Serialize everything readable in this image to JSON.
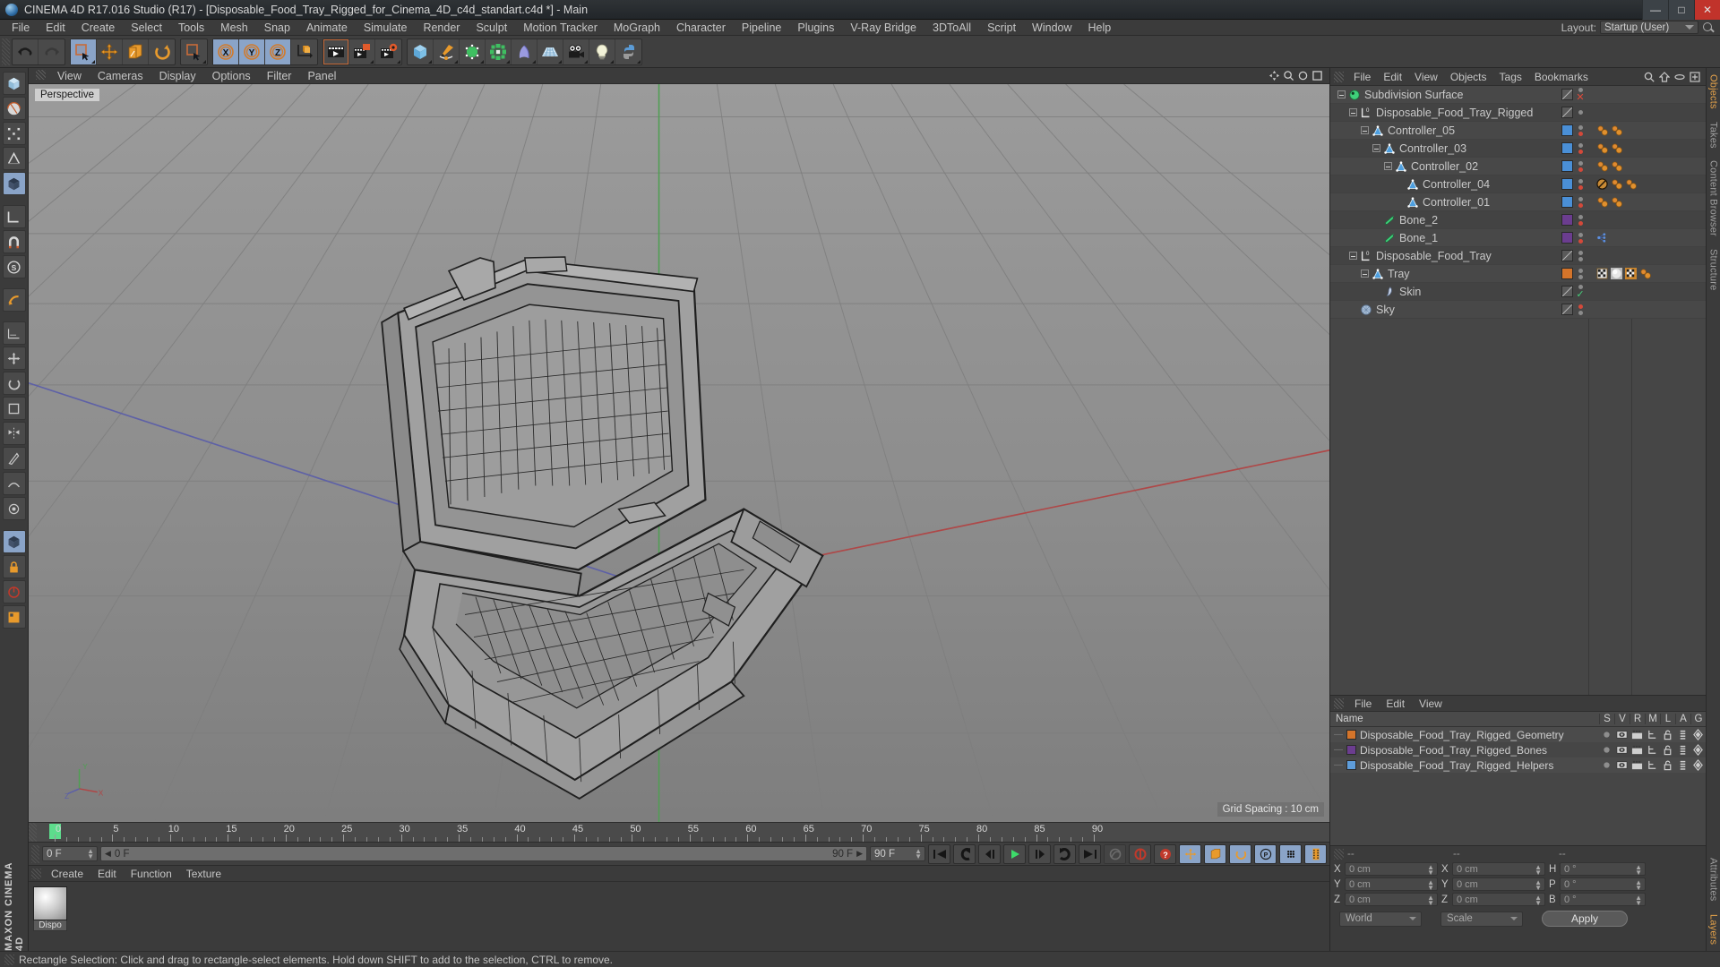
{
  "window": {
    "title": "CINEMA 4D R17.016 Studio (R17) - [Disposable_Food_Tray_Rigged_for_Cinema_4D_c4d_standart.c4d *] - Main",
    "minimize": "—",
    "maximize": "□",
    "close": "✕"
  },
  "menubar": {
    "items": [
      "File",
      "Edit",
      "Create",
      "Select",
      "Tools",
      "Mesh",
      "Snap",
      "Animate",
      "Simulate",
      "Render",
      "Sculpt",
      "Motion Tracker",
      "MoGraph",
      "Character",
      "Pipeline",
      "Plugins",
      "V-Ray Bridge",
      "3DToAll",
      "Script",
      "Window",
      "Help"
    ],
    "layout_label": "Layout:",
    "layout_value": "Startup (User)"
  },
  "viewport": {
    "menu": [
      "View",
      "Cameras",
      "Display",
      "Options",
      "Filter",
      "Panel"
    ],
    "label": "Perspective",
    "grid_spacing": "Grid Spacing : 10 cm",
    "axis_x": "X",
    "axis_y": "Y",
    "axis_z": "Z"
  },
  "timeline": {
    "ticks": [
      "0",
      "5",
      "10",
      "15",
      "20",
      "25",
      "30",
      "35",
      "40",
      "45",
      "50",
      "55",
      "60",
      "65",
      "70",
      "75",
      "80",
      "85",
      "90"
    ],
    "current_frame": "0 F",
    "preview_start": "0 F",
    "range_end_right": "90 F",
    "range_end_field": "90 F"
  },
  "material_manager": {
    "menu": [
      "Create",
      "Edit",
      "Function",
      "Texture"
    ],
    "materials": [
      {
        "name": "Dispo"
      }
    ]
  },
  "object_manager": {
    "menu": [
      "File",
      "Edit",
      "View",
      "Objects",
      "Tags",
      "Bookmarks"
    ],
    "tree": [
      {
        "name": "Subdivision Surface",
        "depth": 0,
        "icon": "subdivision-surface",
        "expander": "minus",
        "swatch": "none",
        "dots": [
          "gray",
          "red-x"
        ],
        "tags": []
      },
      {
        "name": "Disposable_Food_Tray_Rigged",
        "depth": 1,
        "icon": "layer-null",
        "expander": "minus",
        "swatch": "none",
        "dots": [
          "gray"
        ],
        "tags": []
      },
      {
        "name": "Controller_05",
        "depth": 2,
        "icon": "joint",
        "expander": "minus",
        "swatch": "#4a8fd6",
        "dots": [
          "gray",
          "red"
        ],
        "tags": [
          "constraint",
          "constraint"
        ]
      },
      {
        "name": "Controller_03",
        "depth": 3,
        "icon": "joint",
        "expander": "minus",
        "swatch": "#4a8fd6",
        "dots": [
          "gray",
          "red"
        ],
        "tags": [
          "constraint",
          "constraint"
        ]
      },
      {
        "name": "Controller_02",
        "depth": 4,
        "icon": "joint",
        "expander": "minus",
        "swatch": "#4a8fd6",
        "dots": [
          "gray",
          "red"
        ],
        "tags": [
          "constraint",
          "constraint"
        ]
      },
      {
        "name": "Controller_04",
        "depth": 5,
        "icon": "joint",
        "expander": "none",
        "swatch": "#4a8fd6",
        "dots": [
          "gray",
          "red"
        ],
        "tags": [
          "protection",
          "constraint",
          "constraint"
        ]
      },
      {
        "name": "Controller_01",
        "depth": 5,
        "icon": "joint",
        "expander": "none",
        "swatch": "#4a8fd6",
        "dots": [
          "gray",
          "red"
        ],
        "tags": [
          "constraint",
          "constraint"
        ]
      },
      {
        "name": "Bone_2",
        "depth": 3,
        "icon": "bone",
        "expander": "none",
        "swatch": "#6b3d8f",
        "dots": [
          "gray",
          "red"
        ],
        "tags": []
      },
      {
        "name": "Bone_1",
        "depth": 3,
        "icon": "bone",
        "expander": "none",
        "swatch": "#6b3d8f",
        "dots": [
          "gray",
          "red"
        ],
        "tags": [
          "weight"
        ]
      },
      {
        "name": "Disposable_Food_Tray",
        "depth": 1,
        "icon": "layer-null",
        "expander": "minus",
        "swatch": "none",
        "dots": [
          "gray",
          "gray"
        ],
        "tags": []
      },
      {
        "name": "Tray",
        "depth": 2,
        "icon": "joint",
        "expander": "minus",
        "swatch": "#d4742a",
        "dots": [
          "gray",
          "gray"
        ],
        "tags": [
          "selection",
          "material",
          "uv",
          "constraint"
        ]
      },
      {
        "name": "Skin",
        "depth": 3,
        "icon": "skin",
        "expander": "none",
        "swatch": "none",
        "dots": [
          "gray",
          "green-check"
        ],
        "tags": []
      },
      {
        "name": "Sky",
        "depth": 1,
        "icon": "sky",
        "expander": "none",
        "swatch": "none",
        "dots": [
          "red",
          "gray"
        ],
        "tags": []
      }
    ]
  },
  "layer_manager": {
    "menu": [
      "File",
      "Edit",
      "View"
    ],
    "columns": [
      "Name",
      "S",
      "V",
      "R",
      "M",
      "L",
      "A",
      "G"
    ],
    "rows": [
      {
        "name": "Disposable_Food_Tray_Rigged_Geometry",
        "color": "#d4742a"
      },
      {
        "name": "Disposable_Food_Tray_Rigged_Bones",
        "color": "#6b3d8f"
      },
      {
        "name": "Disposable_Food_Tray_Rigged_Helpers",
        "color": "#5e9ddb"
      }
    ]
  },
  "coordinates": {
    "header": [
      "--",
      "--",
      "--"
    ],
    "position_label": [
      "X",
      "Y",
      "Z"
    ],
    "position_values": [
      "0 cm",
      "0 cm",
      "0 cm"
    ],
    "size_label": [
      "X",
      "Y",
      "Z"
    ],
    "size_values": [
      "0 cm",
      "0 cm",
      "0 cm"
    ],
    "rotation_label": [
      "H",
      "P",
      "B"
    ],
    "rotation_values": [
      "0 °",
      "0 °",
      "0 °"
    ],
    "coord_system": "World",
    "mode": "Scale",
    "apply": "Apply"
  },
  "right_tabs": [
    "Objects",
    "Takes",
    "Content Browser",
    "Structure"
  ],
  "lower_right_tabs": [
    "Attributes",
    "Layers"
  ],
  "left_edge_tabs": [
    "Objects",
    "Takes",
    "Content Browser",
    "Structure"
  ],
  "brand": "MAXON CINEMA 4D",
  "statusbar": {
    "message": "Rectangle Selection: Click and drag to rectangle-select elements. Hold down SHIFT to add to the selection, CTRL to remove."
  },
  "toolbar": {
    "groups": [
      {
        "buttons": [
          {
            "icon": "undo-icon",
            "state": "normal"
          },
          {
            "icon": "redo-icon",
            "state": "disabled"
          }
        ]
      },
      {
        "buttons": [
          {
            "icon": "live-selection-icon",
            "state": "selected"
          },
          {
            "icon": "move-icon",
            "state": "normal"
          },
          {
            "icon": "scale-icon",
            "state": "normal"
          },
          {
            "icon": "rotate-icon",
            "state": "normal"
          }
        ]
      },
      {
        "buttons": [
          {
            "icon": "selection-mode-icon",
            "state": "normal"
          }
        ]
      },
      {
        "buttons": [
          {
            "icon": "x-axis-icon",
            "state": "selected"
          },
          {
            "icon": "y-axis-icon",
            "state": "selected"
          },
          {
            "icon": "z-axis-icon",
            "state": "selected"
          },
          {
            "icon": "world-axis-icon",
            "state": "normal"
          }
        ]
      },
      {
        "buttons": [
          {
            "icon": "render-view-icon",
            "state": "outlined"
          },
          {
            "icon": "render-region-icon",
            "state": "normal"
          },
          {
            "icon": "render-settings-icon",
            "state": "normal"
          }
        ]
      },
      {
        "buttons": [
          {
            "icon": "cube-primitive-icon",
            "state": "normal"
          },
          {
            "icon": "spline-pen-icon",
            "state": "normal"
          },
          {
            "icon": "nurbs-icon",
            "state": "normal"
          },
          {
            "icon": "array-icon",
            "state": "normal"
          },
          {
            "icon": "deformer-icon",
            "state": "normal"
          },
          {
            "icon": "scene-floor-icon",
            "state": "normal"
          },
          {
            "icon": "camera-icon",
            "state": "normal"
          },
          {
            "icon": "light-icon",
            "state": "normal"
          },
          {
            "icon": "python-icon",
            "state": "normal"
          }
        ]
      }
    ]
  },
  "playback": {
    "buttons": [
      "go-to-start",
      "play-backward",
      "step-back",
      "play-forward",
      "step-forward",
      "loop",
      "go-to-end",
      "record-auto",
      "record-keyframe",
      "key-help",
      "move-key",
      "scale-key",
      "rotate-key",
      "param-key",
      "point-key",
      "film"
    ]
  },
  "left_rail": {
    "buttons": [
      "model-mode",
      "texture-mode",
      "points-mode",
      "edges-mode",
      "polygons-mode",
      "workplane-icon",
      "magnet-icon",
      "snap-icon",
      "axis-icon",
      "lock-icon",
      "viewport-icon",
      "layout-icon"
    ]
  }
}
